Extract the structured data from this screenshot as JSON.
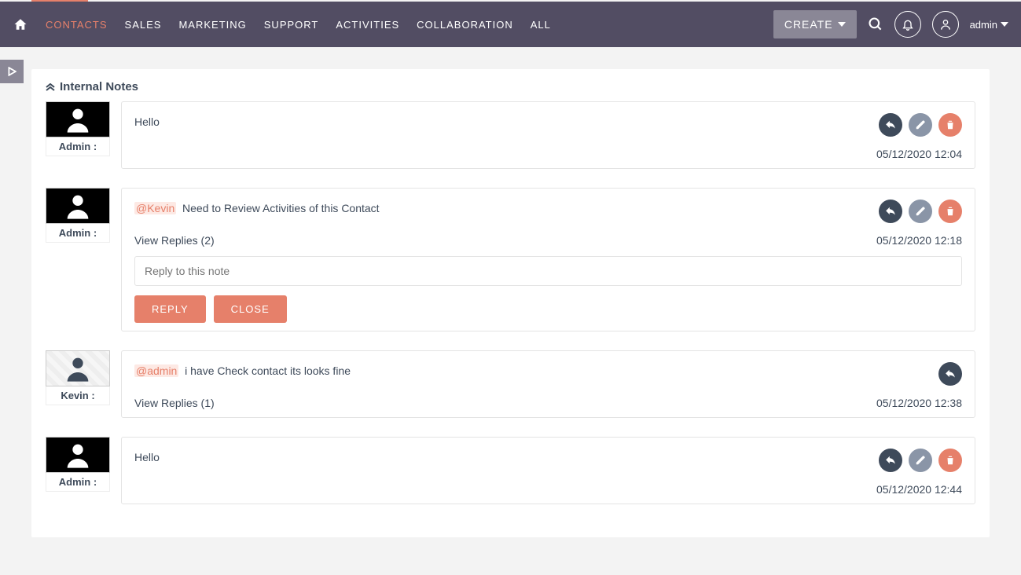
{
  "nav": {
    "items": [
      "CONTACTS",
      "SALES",
      "MARKETING",
      "SUPPORT",
      "ACTIVITIES",
      "COLLABORATION",
      "ALL"
    ],
    "create_label": "CREATE",
    "user_label": "admin"
  },
  "panel": {
    "title": "Internal Notes"
  },
  "notes": [
    {
      "author": "Admin :",
      "avatar": "dark",
      "mention": "",
      "text": "Hello",
      "timestamp": "05/12/2020 12:04",
      "view_replies": "",
      "show_reply_box": false,
      "can_edit": true,
      "can_delete": true
    },
    {
      "author": "Admin :",
      "avatar": "dark",
      "mention": "@Kevin",
      "text": "Need to Review Activities of this Contact",
      "timestamp": "05/12/2020 12:18",
      "view_replies": "View Replies (2)",
      "show_reply_box": true,
      "reply_placeholder": "Reply to this note",
      "reply_button": "REPLY",
      "close_button": "CLOSE",
      "can_edit": true,
      "can_delete": true
    },
    {
      "author": "Kevin :",
      "avatar": "light",
      "mention": "@admin",
      "text": "i have Check contact its looks fine",
      "timestamp": "05/12/2020 12:38",
      "view_replies": "View Replies (1)",
      "show_reply_box": false,
      "can_edit": false,
      "can_delete": false
    },
    {
      "author": "Admin :",
      "avatar": "dark",
      "mention": "",
      "text": "Hello",
      "timestamp": "05/12/2020 12:44",
      "view_replies": "",
      "show_reply_box": false,
      "can_edit": true,
      "can_delete": true
    }
  ]
}
